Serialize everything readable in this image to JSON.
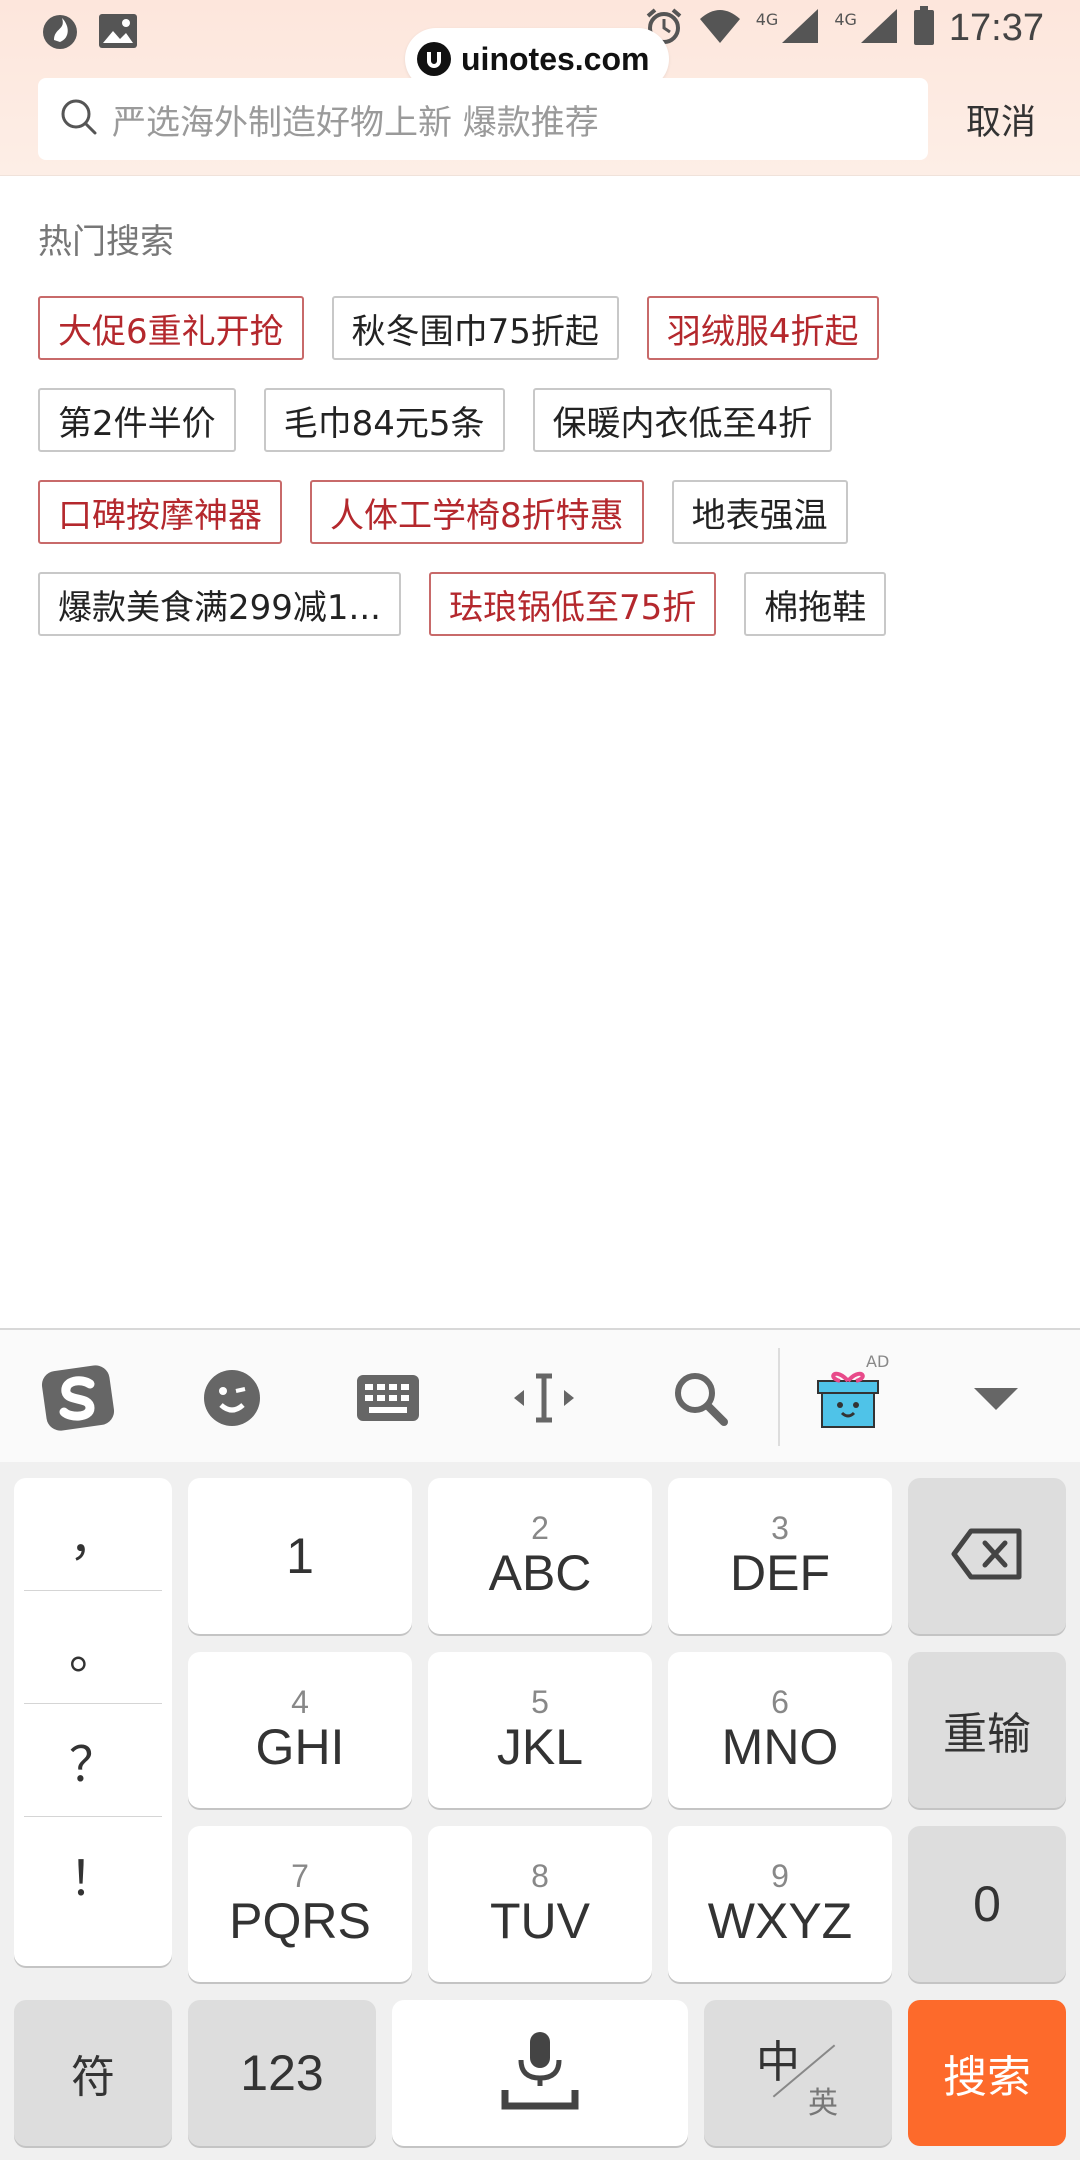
{
  "status_bar": {
    "time": "17:37",
    "network_1": "4G",
    "network_2": "4G"
  },
  "watermark": {
    "text": "uinotes.com"
  },
  "search": {
    "placeholder": "严选海外制造好物上新 爆款推荐",
    "cancel_label": "取消"
  },
  "hot_search": {
    "title": "热门搜索",
    "rows": [
      [
        {
          "label": "大促6重礼开抢",
          "highlight": true
        },
        {
          "label": "秋冬围巾75折起",
          "highlight": false
        },
        {
          "label": "羽绒服4折起",
          "highlight": true
        }
      ],
      [
        {
          "label": "第2件半价",
          "highlight": false
        },
        {
          "label": "毛巾84元5条",
          "highlight": false
        },
        {
          "label": "保暖内衣低至4折",
          "highlight": false
        }
      ],
      [
        {
          "label": "口碑按摩神器",
          "highlight": true
        },
        {
          "label": "人体工学椅8折特惠",
          "highlight": true
        },
        {
          "label": "地表强温",
          "highlight": false
        }
      ],
      [
        {
          "label": "爆款美食满299减1...",
          "highlight": false
        },
        {
          "label": "珐琅锅低至75折",
          "highlight": true
        },
        {
          "label": "棉拖鞋",
          "highlight": false
        }
      ]
    ]
  },
  "keyboard": {
    "toolbar": {
      "ad_label": "AD"
    },
    "punctuation": [
      "，",
      "。",
      "？",
      "！"
    ],
    "keys": {
      "k1": {
        "num": "",
        "main": "1"
      },
      "k2": {
        "num": "2",
        "main": "ABC"
      },
      "k3": {
        "num": "3",
        "main": "DEF"
      },
      "k4": {
        "num": "4",
        "main": "GHI"
      },
      "k5": {
        "num": "5",
        "main": "JKL"
      },
      "k6": {
        "num": "6",
        "main": "MNO"
      },
      "k7": {
        "num": "7",
        "main": "PQRS"
      },
      "k8": {
        "num": "8",
        "main": "TUV"
      },
      "k9": {
        "num": "9",
        "main": "WXYZ"
      }
    },
    "reenter_label": "重输",
    "zero_label": "0",
    "symbol_label": "符",
    "num_label": "123",
    "lang_zh": "中",
    "lang_en": "英",
    "search_label": "搜索"
  },
  "colors": {
    "highlight_text": "#b4282d",
    "search_key": "#fd6a2b",
    "header_bg": "#fde6dc"
  }
}
